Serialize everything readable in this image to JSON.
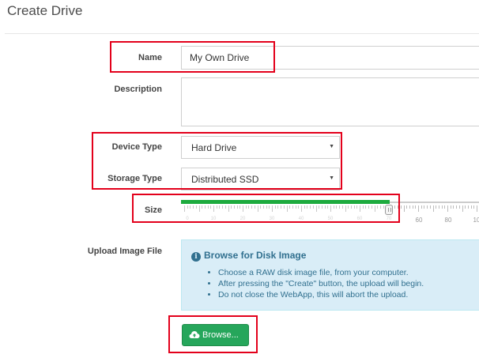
{
  "page": {
    "title": "Create Drive"
  },
  "form": {
    "name": {
      "label": "Name",
      "value": "My Own Drive"
    },
    "description": {
      "label": "Description",
      "value": ""
    },
    "device_type": {
      "label": "Device Type",
      "value": "Hard Drive"
    },
    "storage_type": {
      "label": "Storage Type",
      "value": "Distributed SSD"
    },
    "size": {
      "label": "Size",
      "slider_value_fraction": 0.7,
      "tick_labels": [
        "0",
        "10",
        "20",
        "30",
        "40",
        "50",
        "60",
        "70",
        "60",
        "80",
        "10"
      ]
    },
    "upload": {
      "label": "Upload Image File",
      "info_title": "Browse for Disk Image",
      "info_items": [
        "Choose a RAW disk image file, from your computer.",
        "After pressing the \"Create\" button, the upload will begin.",
        "Do not close the WebApp, this will abort the upload."
      ],
      "browse_label": "Browse..."
    }
  },
  "colors": {
    "slider_fill": "#1dab3e",
    "info_bg": "#d9edf7",
    "info_text": "#31708f",
    "button_bg": "#26a65b",
    "highlight_border": "#e3001b"
  },
  "icons": {
    "info": "info-circle-icon",
    "upload": "cloud-upload-icon",
    "select_caret": "caret-down-icon"
  }
}
